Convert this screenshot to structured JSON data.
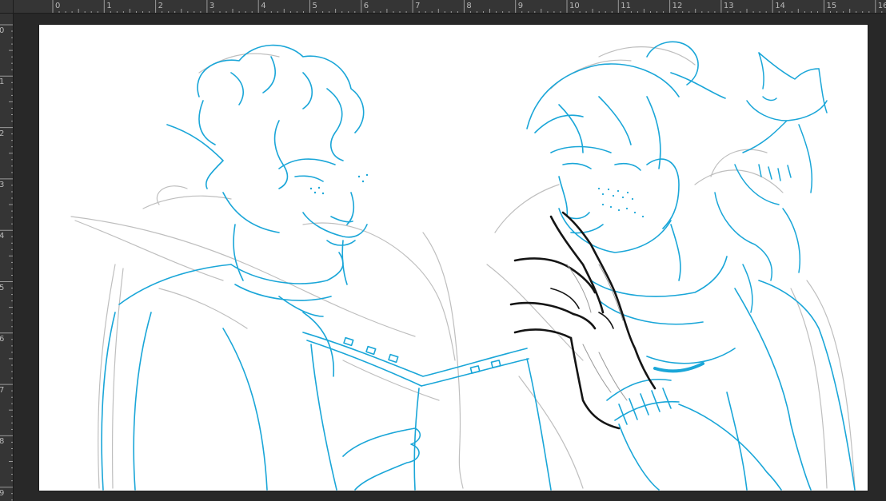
{
  "app": {
    "rulers": {
      "horizontal_labels": [
        "0",
        "1",
        "2",
        "3",
        "4",
        "5",
        "6",
        "7",
        "8",
        "9",
        "10",
        "11",
        "12",
        "13",
        "14",
        "15",
        "16"
      ],
      "vertical_labels": [
        "0",
        "1",
        "2",
        "3",
        "4",
        "5",
        "6",
        "7",
        "8",
        "9"
      ]
    }
  },
  "colors": {
    "ruler_bg": "#353535",
    "workspace_bg": "#282828",
    "canvas_bg": "#ffffff",
    "sketch_blue": "#1aa6d8",
    "sketch_gray": "#b8b8b8",
    "ink_black": "#151515"
  },
  "canvas": {
    "content": "Sketch of two characters: an elf with curly hair reading a book and a bearded man with a cat on his shoulder"
  }
}
